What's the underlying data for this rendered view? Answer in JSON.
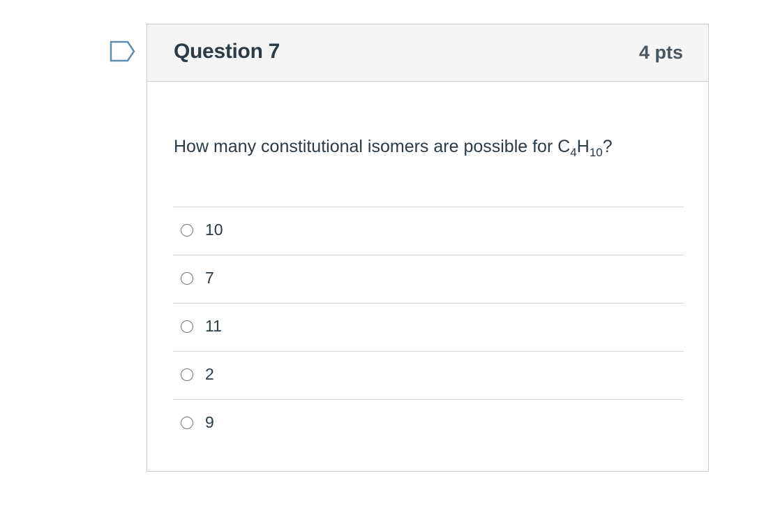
{
  "question": {
    "title": "Question 7",
    "points": "4 pts",
    "text_before": "How many constitutional isomers are possible for C",
    "subscript_1": "4",
    "text_middle": "H",
    "subscript_2": "10",
    "text_after": "?"
  },
  "answers": [
    {
      "label": "10",
      "selected": false
    },
    {
      "label": "7",
      "selected": false
    },
    {
      "label": "11",
      "selected": false
    },
    {
      "label": "2",
      "selected": false
    },
    {
      "label": "9",
      "selected": false
    }
  ],
  "colors": {
    "header_bg": "#f5f5f5",
    "border": "#c7cdd1",
    "text": "#2d3b45",
    "flag_stroke": "#5c8db5"
  },
  "icons": {
    "flag": "flag-bookmark-icon"
  }
}
